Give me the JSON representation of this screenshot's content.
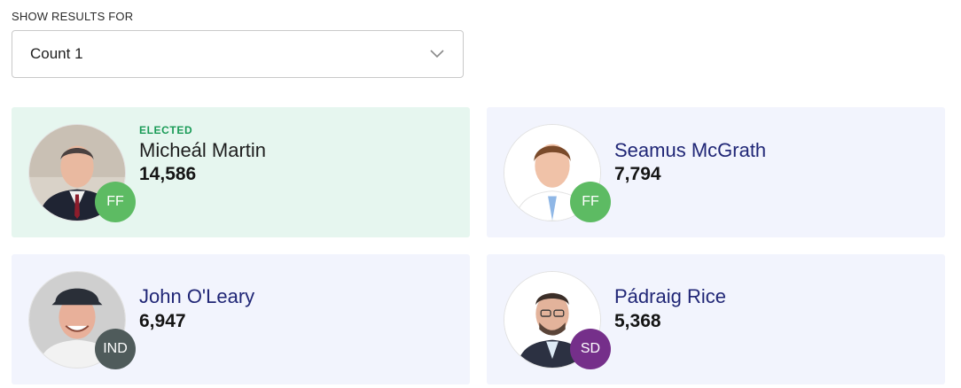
{
  "filter": {
    "label": "SHOW RESULTS FOR",
    "selected": "Count 1",
    "chevron_icon": "chevron-down-icon"
  },
  "party_colors": {
    "FF": "#5dbb63",
    "IND": "#4f5b5b",
    "SD": "#752f8a"
  },
  "candidates": [
    {
      "status": "ELECTED",
      "name": "Micheál Martin",
      "votes": "14,586",
      "party": "FF"
    },
    {
      "status": "",
      "name": "Seamus McGrath",
      "votes": "7,794",
      "party": "FF"
    },
    {
      "status": "",
      "name": "John O'Leary",
      "votes": "6,947",
      "party": "IND"
    },
    {
      "status": "",
      "name": "Pádraig Rice",
      "votes": "5,368",
      "party": "SD"
    }
  ]
}
